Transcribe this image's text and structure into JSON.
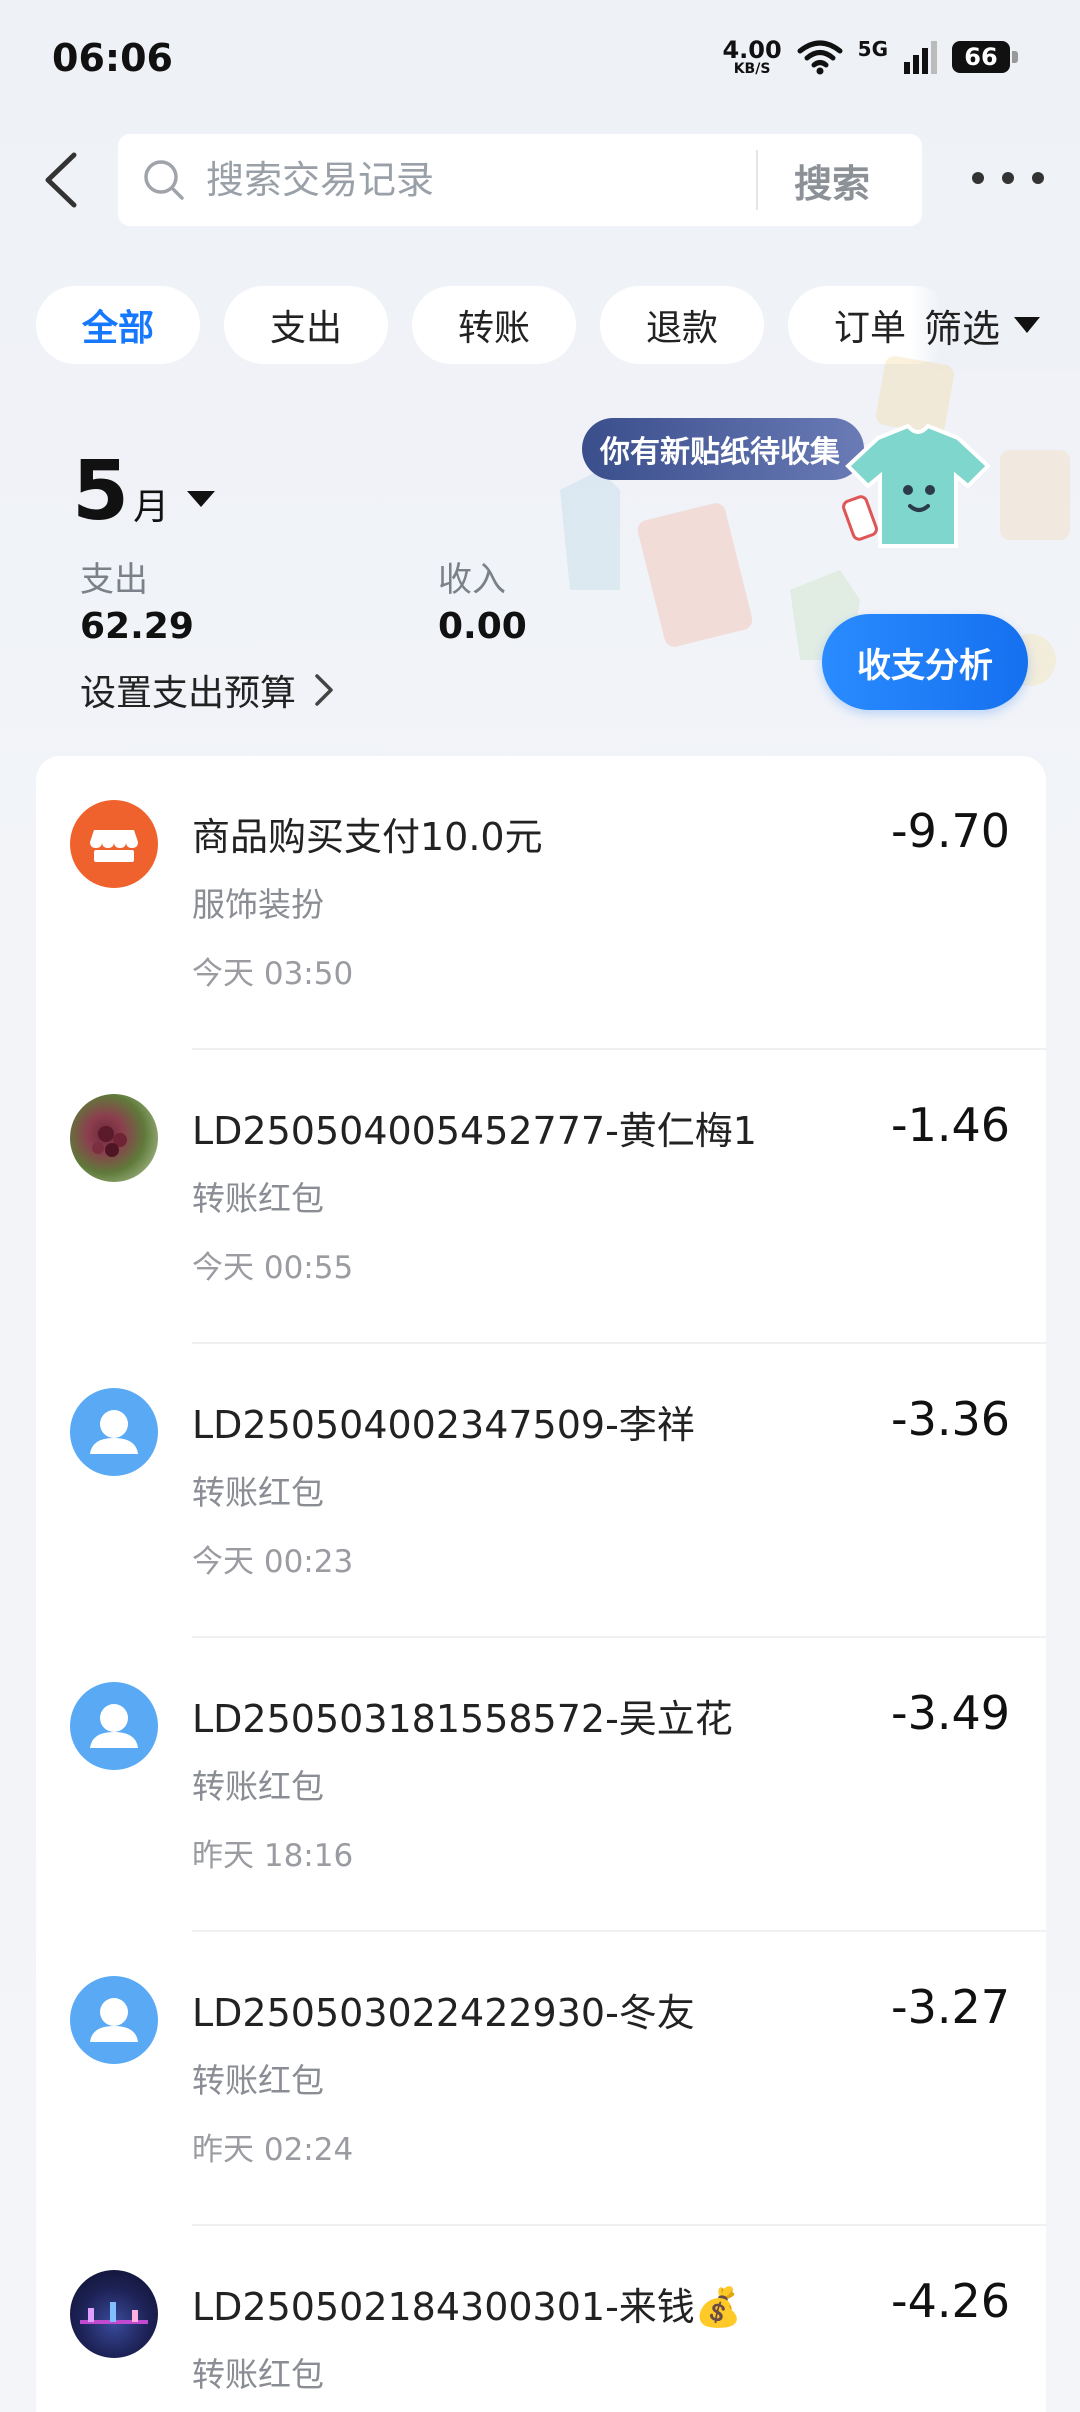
{
  "status_bar": {
    "time": "06:06",
    "net_speed_value": "4.00",
    "net_speed_unit": "KB/S",
    "network": "5G",
    "battery": "66"
  },
  "header": {
    "search_placeholder": "搜索交易记录",
    "search_button": "搜索"
  },
  "filters": {
    "chips": [
      "全部",
      "支出",
      "转账",
      "退款",
      "订单"
    ],
    "active": "全部",
    "filter_button": "筛选"
  },
  "summary": {
    "month": "5",
    "month_unit": "月",
    "expense_label": "支出",
    "expense_value": "62.29",
    "income_label": "收入",
    "income_value": "0.00",
    "budget_link": "设置支出预算",
    "sticker_bubble": "你有新贴纸待收集",
    "analysis_button": "收支分析"
  },
  "transactions": [
    {
      "title": "商品购买支付10.0元",
      "category": "服饰装扮",
      "time": "今天 03:50",
      "amount": "-9.70",
      "avatar": "shop-icon"
    },
    {
      "title": "LD250504005452777-黄仁梅1",
      "category": "转账红包",
      "time": "今天 00:55",
      "amount": "-1.46",
      "avatar": "photo-avatar"
    },
    {
      "title": "LD250504002347509-李祥",
      "category": "转账红包",
      "time": "今天 00:23",
      "amount": "-3.36",
      "avatar": "user-icon"
    },
    {
      "title": "LD250503181558572-吴立花",
      "category": "转账红包",
      "time": "昨天 18:16",
      "amount": "-3.49",
      "avatar": "user-icon"
    },
    {
      "title": "LD250503022422930-冬友",
      "category": "转账红包",
      "time": "昨天 02:24",
      "amount": "-3.27",
      "avatar": "user-icon"
    },
    {
      "title": "LD250502184300301-来钱💰",
      "category": "转账红包",
      "time": "",
      "amount": "-4.26",
      "avatar": "photo-avatar-night"
    }
  ],
  "colors": {
    "accent": "#1677ff",
    "shop_orange": "#f0622d",
    "user_blue": "#5aa9f5"
  }
}
